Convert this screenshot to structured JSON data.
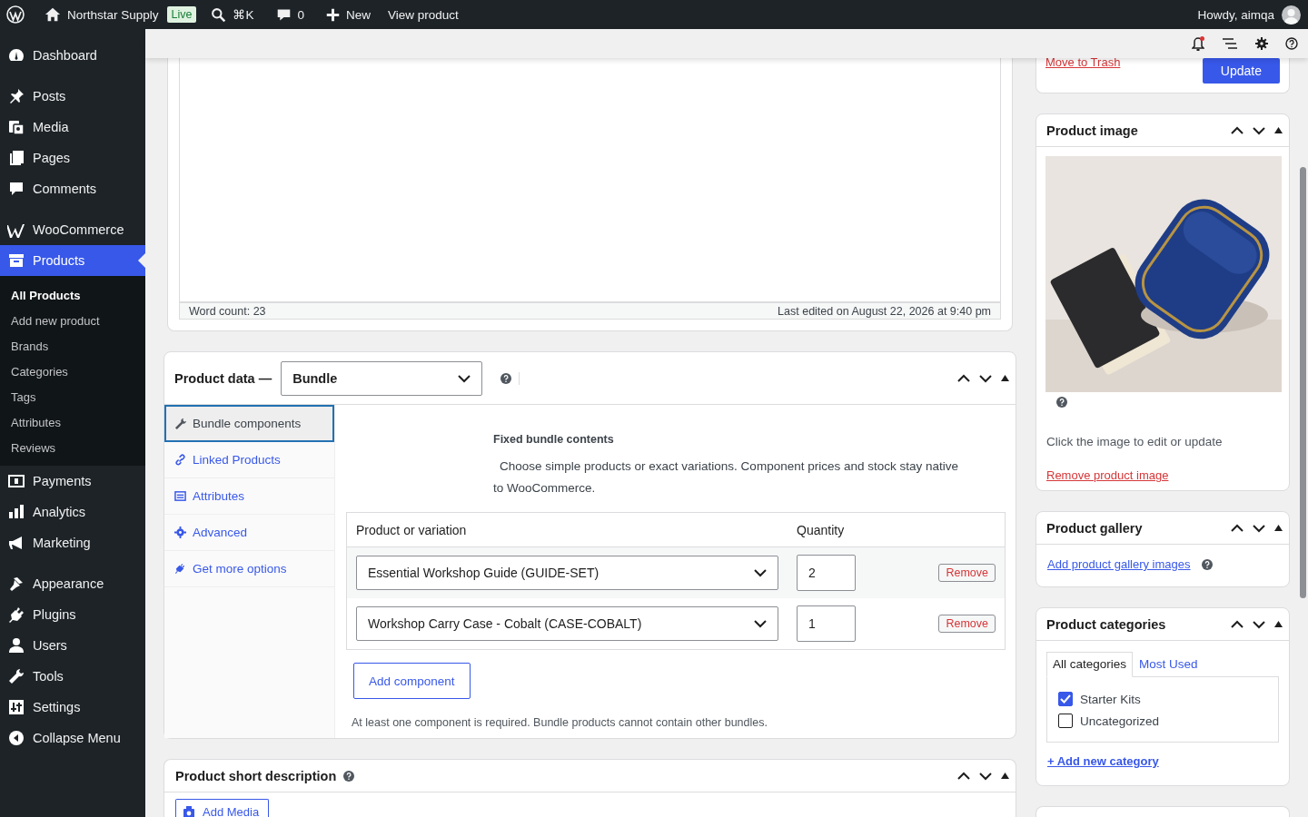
{
  "admin_bar": {
    "site_name": "Northstar Supply",
    "badge": "Live",
    "shortcut": "⌘K",
    "comments": "0",
    "new": "New",
    "view": "View product",
    "greeting": "Howdy, aimqa"
  },
  "sidebar": {
    "groups": [
      [
        {
          "label": "Dashboard",
          "selected": false
        }
      ],
      [
        {
          "label": "Posts",
          "selected": false
        },
        {
          "label": "Media",
          "selected": false
        },
        {
          "label": "Pages",
          "selected": false
        },
        {
          "label": "Comments",
          "selected": false
        }
      ],
      [
        {
          "label": "WooCommerce",
          "selected": false
        },
        {
          "label": "Products",
          "selected": true,
          "children": [
            {
              "label": "All Products",
              "selected": true
            },
            {
              "label": "Add new product",
              "selected": false
            },
            {
              "label": "Brands",
              "selected": false
            },
            {
              "label": "Categories",
              "selected": false
            },
            {
              "label": "Tags",
              "selected": false
            },
            {
              "label": "Attributes",
              "selected": false
            },
            {
              "label": "Reviews",
              "selected": false
            }
          ]
        },
        {
          "label": "Payments",
          "selected": false
        },
        {
          "label": "Analytics",
          "selected": false
        },
        {
          "label": "Marketing",
          "selected": false
        }
      ],
      [
        {
          "label": "Appearance",
          "selected": false
        },
        {
          "label": "Plugins",
          "selected": false
        },
        {
          "label": "Users",
          "selected": false
        },
        {
          "label": "Tools",
          "selected": false
        },
        {
          "label": "Settings",
          "selected": false
        },
        {
          "label": "Collapse Menu",
          "selected": false
        }
      ]
    ]
  },
  "editor": {
    "word_count": "Word count: 23",
    "last_edited": "Last edited on August 22, 2026 at 9:40 pm"
  },
  "publish": {
    "trash_link": "Move to Trash",
    "update_button": "Update"
  },
  "product_data": {
    "title": "Product data —",
    "type": "Bundle",
    "tabs": [
      {
        "label": "Bundle components",
        "selected": true
      },
      {
        "label": "Linked Products",
        "selected": false
      },
      {
        "label": "Attributes",
        "selected": false
      },
      {
        "label": "Advanced",
        "selected": false
      },
      {
        "label": "Get more options",
        "selected": false
      }
    ],
    "section_title": "Fixed bundle contents",
    "description": "Choose simple products or exact variations. Component prices and stock stay native to WooCommerce.",
    "table": {
      "columns": [
        "Product or variation",
        "Quantity"
      ],
      "rows": [
        {
          "product": "Essential Workshop Guide (GUIDE-SET)",
          "quantity": "2",
          "remove": "Remove"
        },
        {
          "product": "Workshop Carry Case - Cobalt (CASE-COBALT)",
          "quantity": "1",
          "remove": "Remove"
        }
      ]
    },
    "add_button": "Add component",
    "note": "At least one component is required. Bundle products cannot contain other bundles."
  },
  "short_description": {
    "title": "Product short description",
    "add_media": "Add Media"
  },
  "product_image": {
    "title": "Product image",
    "hint": "Click the image to edit or update",
    "remove_link": "Remove product image"
  },
  "product_gallery": {
    "title": "Product gallery",
    "add_link": "Add product gallery images"
  },
  "product_categories": {
    "title": "Product categories",
    "tabs": [
      {
        "label": "All categories",
        "selected": true
      },
      {
        "label": "Most Used",
        "selected": false
      }
    ],
    "items": [
      {
        "label": "Starter Kits",
        "checked": true
      },
      {
        "label": "Uncategorized",
        "checked": false
      }
    ],
    "add_link": "+ Add new category"
  }
}
